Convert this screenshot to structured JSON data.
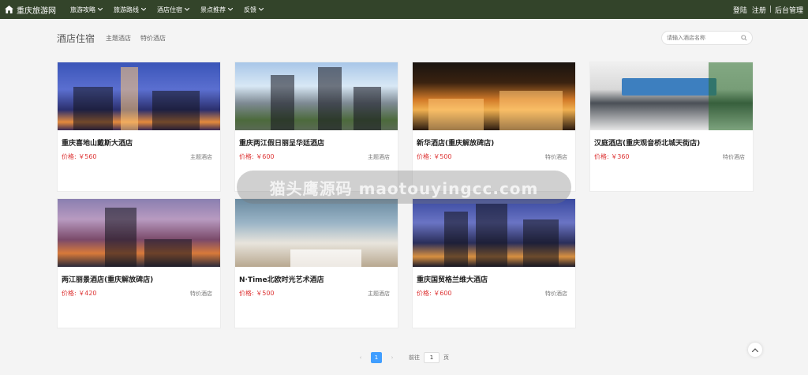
{
  "nav": {
    "brand": "重庆旅游网",
    "items": [
      {
        "label": "旅游攻略"
      },
      {
        "label": "旅游路线"
      },
      {
        "label": "酒店住宿"
      },
      {
        "label": "景点推荐"
      },
      {
        "label": "反馈"
      }
    ],
    "login": "登陆",
    "register": "注册",
    "separator": "|",
    "admin": "后台管理"
  },
  "header": {
    "title": "酒店住宿",
    "tabs": [
      {
        "label": "主题酒店"
      },
      {
        "label": "特价酒店"
      }
    ],
    "search_placeholder": "请输入酒店名称"
  },
  "hotels": [
    {
      "name": "重庆喜地山戴斯大酒店",
      "price": "价格: ￥560",
      "tag": "主题酒店"
    },
    {
      "name": "重庆两江假日丽呈华廷酒店",
      "price": "价格: ￥600",
      "tag": "主题酒店"
    },
    {
      "name": "新华酒店(重庆解放碑店)",
      "price": "价格: ￥500",
      "tag": "特价酒店"
    },
    {
      "name": "汉庭酒店(重庆观音桥北城天街店)",
      "price": "价格: ￥360",
      "tag": "特价酒店"
    },
    {
      "name": "两江丽景酒店(重庆解放碑店)",
      "price": "价格: ￥420",
      "tag": "特价酒店"
    },
    {
      "name": "N·Time北欧时光艺术酒店",
      "price": "价格: ￥500",
      "tag": "主题酒店"
    },
    {
      "name": "重庆国贸格兰维大酒店",
      "price": "价格: ￥600",
      "tag": "特价酒店"
    }
  ],
  "watermark": "猫头鹰源码 maotouyingcc.com",
  "pagination": {
    "current_page": "1",
    "goto_label": "前往",
    "goto_value": "1",
    "page_suffix": "页"
  },
  "colors": {
    "navbar": "#33442a",
    "price": "#d33333",
    "page_active": "#409eff"
  }
}
